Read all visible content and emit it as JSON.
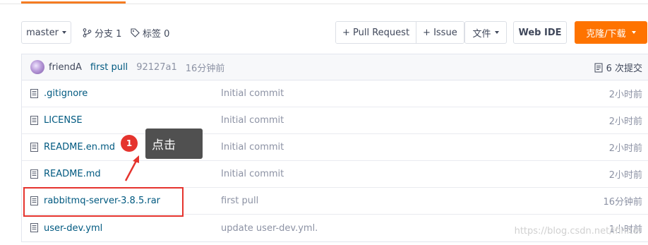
{
  "toolbar": {
    "branch_select": "master",
    "branches_label": "分支 1",
    "tags_label": "标签 0",
    "pull_request_label": "+ Pull Request",
    "issue_label": "+ Issue",
    "file_menu_label": "文件",
    "webide_label": "Web IDE",
    "clone_download_label": "克隆/下载"
  },
  "latest_commit": {
    "author": "friendA",
    "message": "first pull",
    "sha": "92127a1",
    "time": "16分钟前",
    "commits_count": "6 次提交"
  },
  "files": [
    {
      "name": ".gitignore",
      "commit_message": "Initial commit",
      "time": "2小时前"
    },
    {
      "name": "LICENSE",
      "commit_message": "Initial commit",
      "time": "2小时前"
    },
    {
      "name": "README.en.md",
      "commit_message": "Initial commit",
      "time": "2小时前"
    },
    {
      "name": "README.md",
      "commit_message": "Initial commit",
      "time": "2小时前"
    },
    {
      "name": "rabbitmq-server-3.8.5.rar",
      "commit_message": "first pull",
      "time": "16分钟前"
    },
    {
      "name": "user-dev.yml",
      "commit_message": "update user-dev.yml.",
      "time": "1小时前"
    }
  ],
  "annotation": {
    "step_number": "1",
    "tooltip_text": "点击"
  },
  "watermark": "https://blog.csdn.net/ifinitel",
  "colors": {
    "accent_orange": "#fe7300",
    "link_blue": "#005980",
    "highlight_red": "#e5342e"
  }
}
